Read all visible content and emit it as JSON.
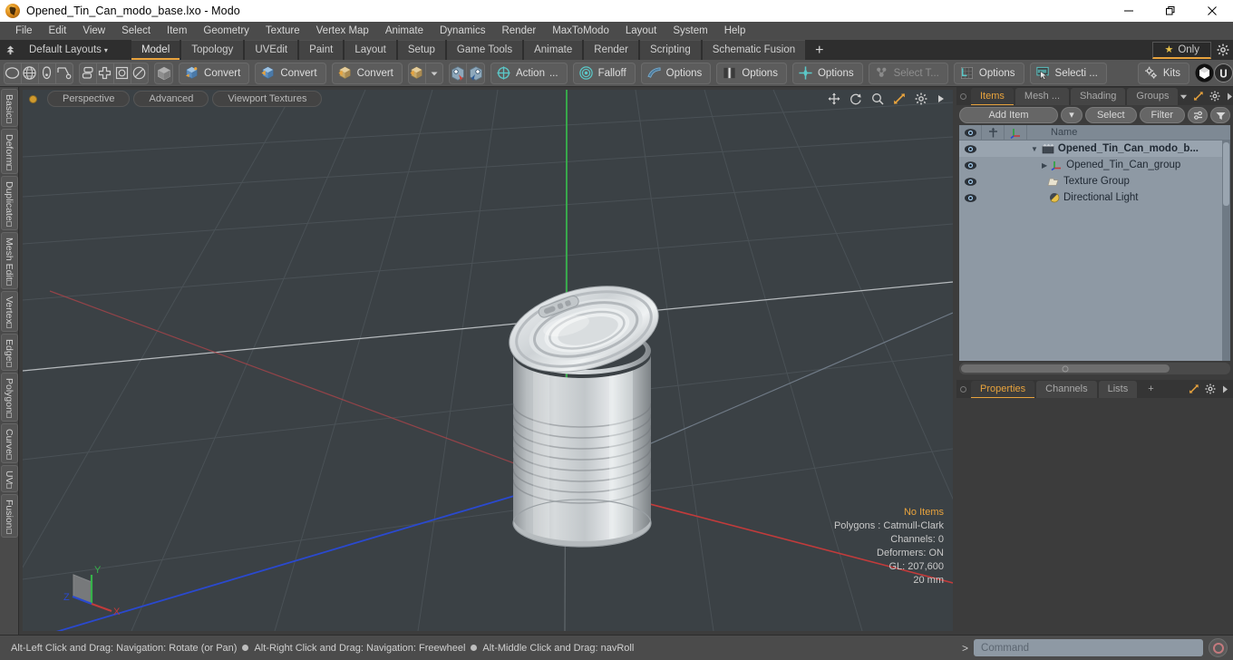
{
  "window": {
    "title": "Opened_Tin_Can_modo_base.lxo - Modo",
    "app_icon": "modo-logo-icon",
    "minimize": "minimize-icon",
    "maximize": "restore-icon",
    "close": "close-icon"
  },
  "menubar": {
    "items": [
      {
        "label": "File"
      },
      {
        "label": "Edit"
      },
      {
        "label": "View"
      },
      {
        "label": "Select"
      },
      {
        "label": "Item"
      },
      {
        "label": "Geometry"
      },
      {
        "label": "Texture"
      },
      {
        "label": "Vertex Map"
      },
      {
        "label": "Animate"
      },
      {
        "label": "Dynamics"
      },
      {
        "label": "Render"
      },
      {
        "label": "MaxToModo"
      },
      {
        "label": "Layout"
      },
      {
        "label": "System"
      },
      {
        "label": "Help"
      }
    ]
  },
  "layoutbar": {
    "default_layouts": "Default Layouts",
    "caret": "▾",
    "tabs": [
      {
        "label": "Model",
        "active": true
      },
      {
        "label": "Topology",
        "active": false
      },
      {
        "label": "UVEdit",
        "active": false
      },
      {
        "label": "Paint",
        "active": false
      },
      {
        "label": "Layout",
        "active": false
      },
      {
        "label": "Setup",
        "active": false
      },
      {
        "label": "Game Tools",
        "active": false
      },
      {
        "label": "Animate",
        "active": false
      },
      {
        "label": "Render",
        "active": false
      },
      {
        "label": "Scripting",
        "active": false
      },
      {
        "label": "Schematic Fusion",
        "active": false
      }
    ],
    "add_tab": "+",
    "only_label": "Only",
    "only_star": "★"
  },
  "toolbar": {
    "shape_icons": [
      "circle-icon",
      "globe-icon",
      "pen-icon",
      "curve-icon"
    ],
    "mode_icons": [
      "mirror-icon",
      "symmetry-icon",
      "center-icon",
      "radial-icon"
    ],
    "solid_icon": "solid-cube-icon",
    "convert_1": "Convert",
    "convert_2": "Convert",
    "convert_3": "Convert",
    "convert_dropdown_caret": "▾",
    "action": "Action",
    "action_ellipsis": "...",
    "falloff": "Falloff",
    "options_1": "Options",
    "options_2": "Options",
    "options_3": "Options",
    "select_through": "Select T...",
    "options_4": "Options",
    "selection": "Selecti ...",
    "kits": "Kits"
  },
  "left_rail": {
    "tabs": [
      {
        "label": "Basic"
      },
      {
        "label": "Deform"
      },
      {
        "label": "Duplicate"
      },
      {
        "label": "Mesh Edit"
      },
      {
        "label": "Vertex"
      },
      {
        "label": "Edge"
      },
      {
        "label": "Polygon"
      },
      {
        "label": "Curve"
      },
      {
        "label": "UV"
      },
      {
        "label": "Fusion"
      }
    ]
  },
  "viewport": {
    "view_mode": "Perspective",
    "shading": "Advanced",
    "textures": "Viewport Textures",
    "header_icons": [
      "pan-icon",
      "rotate-icon",
      "zoom-icon",
      "fit-icon",
      "gear-icon",
      "chevron-right-icon"
    ],
    "stats": {
      "no_items": "No Items",
      "polygons": "Polygons : Catmull-Clark",
      "channels": "Channels: 0",
      "deformers": "Deformers: ON",
      "gl": "GL: 207,600",
      "scale": "20 mm"
    },
    "axis_gizmo": {
      "x": "X",
      "y": "Y",
      "z": "Z"
    },
    "colors": {
      "background": "#3b4145",
      "grid": "#4a5055",
      "axis_x": "#c23b3b",
      "axis_y": "#36b24a",
      "axis_z": "#2a49cf"
    },
    "model_name": "opened-tin-can-3d-model"
  },
  "right_panel": {
    "tabs": [
      {
        "label": "Items",
        "active": true
      },
      {
        "label": "Mesh ...",
        "active": false
      },
      {
        "label": "Shading",
        "active": false
      },
      {
        "label": "Groups",
        "active": false
      }
    ],
    "tab_icons": [
      "chevron-down-icon",
      "expand-icon",
      "gear-icon",
      "chevron-right-icon"
    ],
    "toolrow": {
      "add_item": "Add Item",
      "add_item_caret": "▾",
      "select": "Select",
      "filter": "Filter",
      "list_icon": "list-options-icon",
      "funnel_icon": "funnel-icon"
    },
    "list_headers": {
      "visibility": "eye-icon",
      "lock": "pin-icon",
      "transform": "axis-icon",
      "name": "Name"
    },
    "items": [
      {
        "label": "Opened_Tin_Can_modo_b...",
        "icon": "scene-icon",
        "depth": 0,
        "bold": true,
        "selected": true,
        "expander": "▼"
      },
      {
        "label": "Opened_Tin_Can_group",
        "icon": "axis-icon",
        "depth": 1,
        "bold": false,
        "selected": false,
        "expander": "▶"
      },
      {
        "label": "Texture Group",
        "icon": "folder-icon",
        "depth": 1,
        "bold": false,
        "selected": false,
        "expander": ""
      },
      {
        "label": "Directional Light",
        "icon": "light-icon",
        "depth": 1,
        "bold": false,
        "selected": false,
        "expander": ""
      }
    ],
    "properties_tabs": [
      {
        "label": "Properties",
        "active": true
      },
      {
        "label": "Channels",
        "active": false
      },
      {
        "label": "Lists",
        "active": false
      },
      {
        "label": "+",
        "active": false
      }
    ]
  },
  "statusbar": {
    "hints": [
      "Alt-Left Click and Drag: Navigation: Rotate (or Pan)",
      "Alt-Right Click and Drag: Navigation: Freewheel",
      "Alt-Middle Click and Drag: navRoll"
    ],
    "command_chevron": ">",
    "command_placeholder": "Command",
    "record_icon": "record-icon"
  },
  "colors": {
    "accent": "#e8a33d",
    "panel_bg": "#3c3c3c",
    "toolbar_bg": "#555555",
    "list_bg": "#8e99a4"
  }
}
